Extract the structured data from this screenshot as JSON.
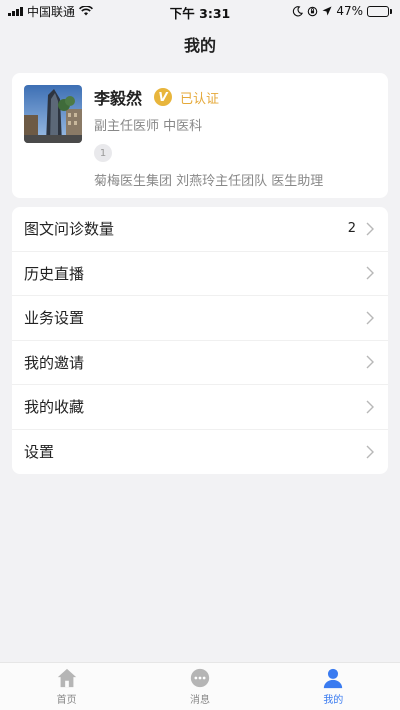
{
  "status_bar": {
    "carrier": "中国联通",
    "time": "下午 3:31",
    "battery": "47%",
    "battery_level": 0.47
  },
  "nav": {
    "title": "我的"
  },
  "profile": {
    "name": "李毅然",
    "verify_icon_text": "V",
    "verify_text": "已认证",
    "title": "副主任医师 中医科",
    "badge_count": "1",
    "team": "菊梅医生集团 刘燕玲主任团队 医生助理"
  },
  "menu": {
    "items": [
      {
        "label": "图文问诊数量",
        "count": "2"
      },
      {
        "label": "历史直播"
      },
      {
        "label": "业务设置"
      },
      {
        "label": "我的邀请"
      },
      {
        "label": "我的收藏"
      },
      {
        "label": "设置"
      }
    ]
  },
  "tab_bar": {
    "tabs": [
      {
        "label": "首页",
        "icon": "home-icon"
      },
      {
        "label": "消息",
        "icon": "chat-icon"
      },
      {
        "label": "我的",
        "icon": "person-icon"
      }
    ],
    "active_color": "#3a7bf0",
    "inactive_color": "#b5b5b5"
  }
}
